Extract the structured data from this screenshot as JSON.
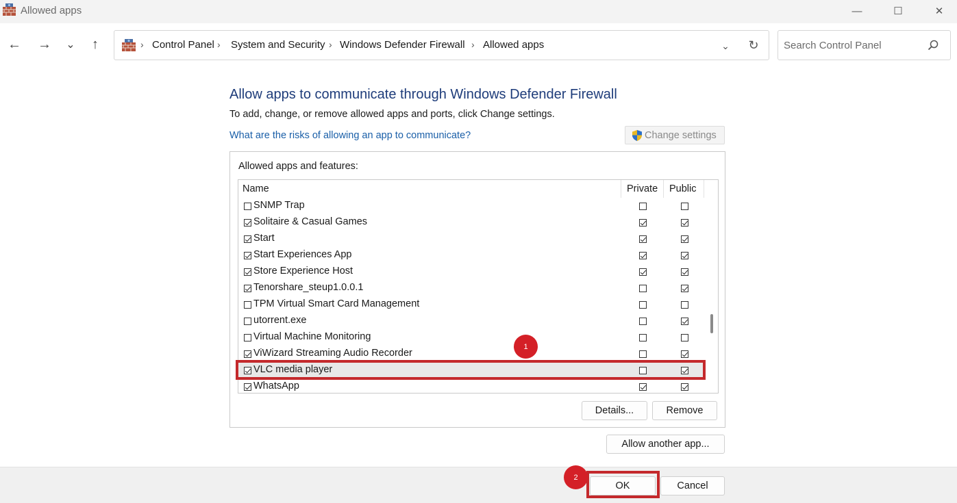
{
  "window": {
    "title": "Allowed apps",
    "minimize_glyph": "—",
    "maximize_glyph": "☐",
    "close_glyph": "✕"
  },
  "nav": {
    "back_glyph": "←",
    "forward_glyph": "→",
    "recent_glyph": "⌄",
    "up_glyph": "↑"
  },
  "address": {
    "breadcrumb": [
      "Control Panel",
      "System and Security",
      "Windows Defender Firewall",
      "Allowed apps"
    ],
    "separator": "›",
    "dropdown_glyph": "⌄",
    "refresh_glyph": "↻"
  },
  "search": {
    "placeholder": "Search Control Panel"
  },
  "main": {
    "heading": "Allow apps to communicate through Windows Defender Firewall",
    "subtext": "To add, change, or remove allowed apps and ports, click Change settings.",
    "risk_link": "What are the risks of allowing an app to communicate?",
    "change_settings_label": "Change settings",
    "group_label": "Allowed apps and features:",
    "columns": {
      "name": "Name",
      "private": "Private",
      "public": "Public"
    },
    "apps": [
      {
        "name": "SNMP Trap",
        "enabled": false,
        "private": false,
        "public": false
      },
      {
        "name": "Solitaire & Casual Games",
        "enabled": true,
        "private": true,
        "public": true
      },
      {
        "name": "Start",
        "enabled": true,
        "private": true,
        "public": true
      },
      {
        "name": "Start Experiences App",
        "enabled": true,
        "private": true,
        "public": true
      },
      {
        "name": "Store Experience Host",
        "enabled": true,
        "private": true,
        "public": true
      },
      {
        "name": "Tenorshare_steup1.0.0.1",
        "enabled": true,
        "private": false,
        "public": true
      },
      {
        "name": "TPM Virtual Smart Card Management",
        "enabled": false,
        "private": false,
        "public": false
      },
      {
        "name": "utorrent.exe",
        "enabled": false,
        "private": false,
        "public": true
      },
      {
        "name": "Virtual Machine Monitoring",
        "enabled": false,
        "private": false,
        "public": false
      },
      {
        "name": "ViWizard Streaming Audio Recorder",
        "enabled": true,
        "private": false,
        "public": true
      },
      {
        "name": "VLC media player",
        "enabled": true,
        "private": false,
        "public": true,
        "highlighted": true
      },
      {
        "name": "WhatsApp",
        "enabled": true,
        "private": true,
        "public": true
      }
    ],
    "details_label": "Details...",
    "remove_label": "Remove",
    "allow_another_label": "Allow another app..."
  },
  "footer": {
    "ok_label": "OK",
    "cancel_label": "Cancel"
  },
  "annotations": {
    "step1": "1",
    "step2": "2",
    "color": "#c4292c"
  },
  "colors": {
    "heading": "#1e3c7a",
    "link": "#1a5fa8"
  }
}
